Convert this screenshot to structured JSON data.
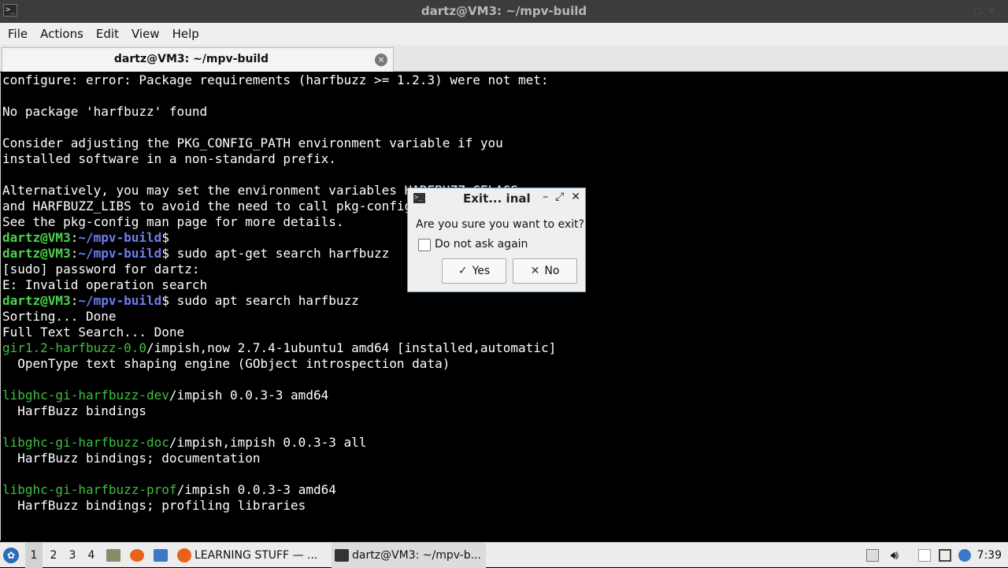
{
  "window": {
    "title": "dartz@VM3: ~/mpv-build",
    "app_icon": ">_"
  },
  "menu": [
    "File",
    "Actions",
    "Edit",
    "View",
    "Help"
  ],
  "tab": {
    "label": "dartz@VM3: ~/mpv-build",
    "close_glyph": "×"
  },
  "terminal": {
    "lines": [
      [
        {
          "t": "configure: error: Package requirements (harfbuzz >= 1.2.3) were not met:",
          "c": ""
        }
      ],
      [
        {
          "t": "",
          "c": ""
        }
      ],
      [
        {
          "t": "No package 'harfbuzz' found",
          "c": ""
        }
      ],
      [
        {
          "t": "",
          "c": ""
        }
      ],
      [
        {
          "t": "Consider adjusting the PKG_CONFIG_PATH environment variable if you",
          "c": ""
        }
      ],
      [
        {
          "t": "installed software in a non-standard prefix.",
          "c": ""
        }
      ],
      [
        {
          "t": "",
          "c": ""
        }
      ],
      [
        {
          "t": "Alternatively, you may set the environment variables HARFBUZZ_CFLAGS",
          "c": ""
        }
      ],
      [
        {
          "t": "and HARFBUZZ_LIBS to avoid the need to call pkg-config.",
          "c": ""
        }
      ],
      [
        {
          "t": "See the pkg-config man page for more details.",
          "c": ""
        }
      ],
      [
        {
          "t": "dartz@VM3",
          "c": "prompt-user"
        },
        {
          "t": ":",
          "c": ""
        },
        {
          "t": "~/mpv-build",
          "c": "prompt-path"
        },
        {
          "t": "$",
          "c": ""
        }
      ],
      [
        {
          "t": "dartz@VM3",
          "c": "prompt-user"
        },
        {
          "t": ":",
          "c": ""
        },
        {
          "t": "~/mpv-build",
          "c": "prompt-path"
        },
        {
          "t": "$ sudo apt-get search harfbuzz",
          "c": ""
        }
      ],
      [
        {
          "t": "[sudo] password for dartz:",
          "c": ""
        }
      ],
      [
        {
          "t": "E: Invalid operation search",
          "c": ""
        }
      ],
      [
        {
          "t": "dartz@VM3",
          "c": "prompt-user"
        },
        {
          "t": ":",
          "c": ""
        },
        {
          "t": "~/mpv-build",
          "c": "prompt-path"
        },
        {
          "t": "$ sudo apt search harfbuzz",
          "c": ""
        }
      ],
      [
        {
          "t": "Sorting... Done",
          "c": ""
        }
      ],
      [
        {
          "t": "Full Text Search... Done",
          "c": ""
        }
      ],
      [
        {
          "t": "gir1.2-harfbuzz-0.0",
          "c": "pkg"
        },
        {
          "t": "/impish,now 2.7.4-1ubuntu1 amd64 [installed,automatic]",
          "c": ""
        }
      ],
      [
        {
          "t": "  OpenType text shaping engine (GObject introspection data)",
          "c": ""
        }
      ],
      [
        {
          "t": "",
          "c": ""
        }
      ],
      [
        {
          "t": "libghc-gi-harfbuzz-dev",
          "c": "pkg"
        },
        {
          "t": "/impish 0.0.3-3 amd64",
          "c": ""
        }
      ],
      [
        {
          "t": "  HarfBuzz bindings",
          "c": ""
        }
      ],
      [
        {
          "t": "",
          "c": ""
        }
      ],
      [
        {
          "t": "libghc-gi-harfbuzz-doc",
          "c": "pkg"
        },
        {
          "t": "/impish,impish 0.0.3-3 all",
          "c": ""
        }
      ],
      [
        {
          "t": "  HarfBuzz bindings; documentation",
          "c": ""
        }
      ],
      [
        {
          "t": "",
          "c": ""
        }
      ],
      [
        {
          "t": "libghc-gi-harfbuzz-prof",
          "c": "pkg"
        },
        {
          "t": "/impish 0.0.3-3 amd64",
          "c": ""
        }
      ],
      [
        {
          "t": "  HarfBuzz bindings; profiling libraries",
          "c": ""
        }
      ]
    ]
  },
  "dialog": {
    "title": "Exit... inal",
    "question": "Are you sure you want to exit?",
    "checkbox_label": "Do not ask again",
    "checkbox_checked": false,
    "yes_label": "Yes",
    "no_label": "No"
  },
  "taskbar": {
    "workspaces": [
      "1",
      "2",
      "3",
      "4"
    ],
    "active_workspace": "1",
    "tasks": [
      {
        "label": "LEARNING STUFF — ...",
        "icon": "firefox-icon"
      },
      {
        "label": "dartz@VM3: ~/mpv-b...",
        "icon": "terminal-icon"
      }
    ],
    "clock": "7:39"
  },
  "colors": {
    "prompt_user": "#4cd34c",
    "prompt_path": "#6d7cf0",
    "package_name": "#3fbf3f",
    "terminal_bg": "#000000"
  }
}
